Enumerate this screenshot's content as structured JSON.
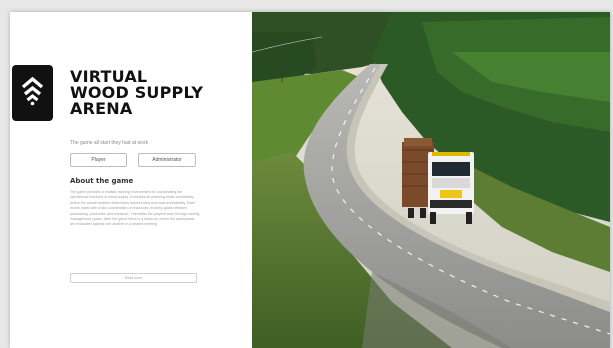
{
  "brand": {
    "line1": "VIRTUAL",
    "line2": "WOOD SUPPLY",
    "line3": "ARENA",
    "logo_icon": "stacked-chevrons-up-icon"
  },
  "tagline": "The game all start they had at work",
  "buttons": {
    "player": "Player",
    "administrator": "Administrator"
  },
  "about": {
    "title": "About the game",
    "text": "The game provides a realistic training environment for coordinating the operational functions of wood supply. It focuses on planning under uncertainty where the actual weather determines harvest area and road accessibility. Each month starts with a fast coordination of resources, monthly goals between purchasing, production and transport. Thereafter the players work through weekly management cycles. After the game there is a follow up where the participants are evaluated against one another in a shared meeting."
  },
  "bottom_button": "Read more",
  "hero": {
    "alt_icon": "timber-truck-road-photo"
  },
  "colors": {
    "logo_bg": "#111111",
    "text_dark": "#111111",
    "forest": "#3f6b2a",
    "road": "#9a9a9a"
  }
}
